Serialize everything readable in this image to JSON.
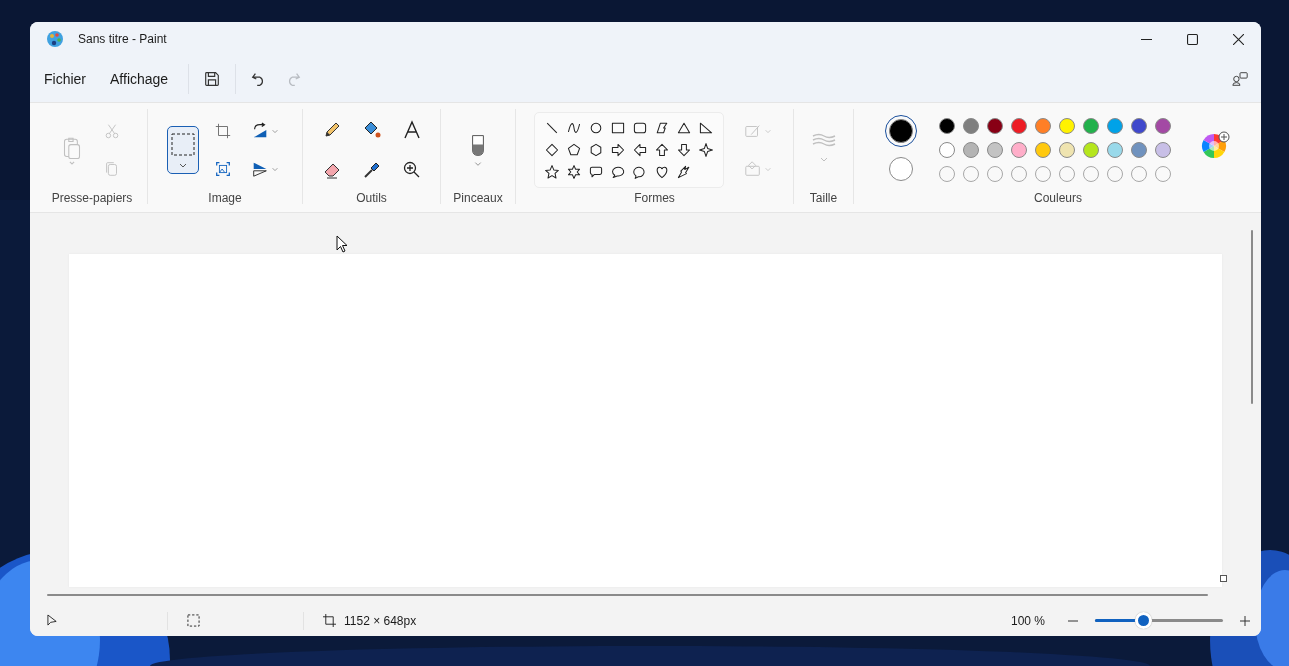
{
  "window": {
    "title": "Sans titre - Paint"
  },
  "menu": [
    {
      "label": "Fichier"
    },
    {
      "label": "Affichage"
    }
  ],
  "quick_access": {
    "undo": {
      "disabled": false
    },
    "redo": {
      "disabled": true
    }
  },
  "ribbon": {
    "clipboard": {
      "label": "Presse-papiers",
      "paste": {
        "disabled": true
      },
      "cut": {
        "disabled": true
      },
      "copy": {
        "disabled": true
      }
    },
    "image": {
      "label": "Image",
      "selection": {
        "selected": true
      }
    },
    "tools": {
      "label": "Outils",
      "items": [
        {
          "kind": "pencil",
          "selected": false
        },
        {
          "kind": "fill",
          "selected": false
        },
        {
          "kind": "text",
          "selected": false
        },
        {
          "kind": "eraser",
          "selected": false
        },
        {
          "kind": "picker",
          "selected": false
        },
        {
          "kind": "magnifier",
          "selected": false
        }
      ]
    },
    "brushes": {
      "label": "Pinceaux"
    },
    "shapes": {
      "label": "Formes",
      "outline": {
        "disabled": true
      },
      "fill": {
        "disabled": true
      }
    },
    "size": {
      "label": "Taille",
      "disabled": true
    },
    "colors": {
      "label": "Couleurs",
      "primary": {
        "color": "#000000",
        "selected": true
      },
      "secondary": {
        "color": "#ffffff",
        "selected": false
      },
      "palette": [
        {
          "color": "#000000"
        },
        {
          "color": "#7f7f7f"
        },
        {
          "color": "#880015"
        },
        {
          "color": "#ed1c24"
        },
        {
          "color": "#ff7f27"
        },
        {
          "color": "#fff200"
        },
        {
          "color": "#22b14c"
        },
        {
          "color": "#00a2e8"
        },
        {
          "color": "#3f48cc"
        },
        {
          "color": "#a349a4"
        },
        {
          "color": "#ffffff"
        },
        {
          "color": "#b4b4b4"
        },
        {
          "color": "#c3c3c3"
        },
        {
          "color": "#ffaec9"
        },
        {
          "color": "#ffc90e"
        },
        {
          "color": "#efe4b0"
        },
        {
          "color": "#b5e61d"
        },
        {
          "color": "#99d9ea"
        },
        {
          "color": "#7092be"
        },
        {
          "color": "#c8bfe7"
        }
      ]
    }
  },
  "status_bar": {
    "canvas_size": "1152 × 648px",
    "zoom": "100 %",
    "zoom_slider": {
      "level": 0.375
    }
  }
}
